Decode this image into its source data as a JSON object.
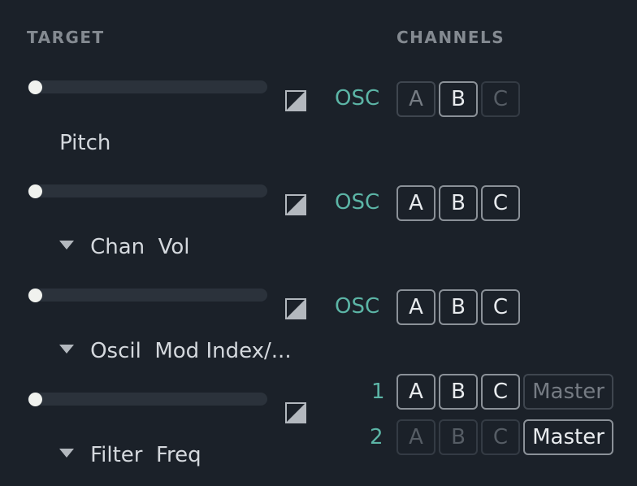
{
  "headers": {
    "target": "TARGET",
    "channels": "CHANNELS"
  },
  "rows": [
    {
      "label": "Pitch",
      "has_dropdown": false,
      "slider_value": 0,
      "prefix": "OSC",
      "buttons": [
        {
          "label": "A",
          "state": "dim"
        },
        {
          "label": "B",
          "state": "on"
        },
        {
          "label": "C",
          "state": "off"
        }
      ]
    },
    {
      "label": "Chan  Vol",
      "has_dropdown": true,
      "slider_value": 0,
      "prefix": "OSC",
      "buttons": [
        {
          "label": "A",
          "state": "on"
        },
        {
          "label": "B",
          "state": "on"
        },
        {
          "label": "C",
          "state": "on"
        }
      ]
    },
    {
      "label": "Oscil  Mod Index/...",
      "has_dropdown": true,
      "slider_value": 0,
      "prefix": "OSC",
      "buttons": [
        {
          "label": "A",
          "state": "on"
        },
        {
          "label": "B",
          "state": "on"
        },
        {
          "label": "C",
          "state": "on"
        }
      ]
    },
    {
      "label": "Filter  Freq",
      "has_dropdown": true,
      "slider_value": 0,
      "filter_rows": [
        {
          "prefix": "1",
          "buttons": [
            {
              "label": "A",
              "state": "on"
            },
            {
              "label": "B",
              "state": "on"
            },
            {
              "label": "C",
              "state": "on"
            },
            {
              "label": "Master",
              "state": "dim"
            }
          ]
        },
        {
          "prefix": "2",
          "buttons": [
            {
              "label": "A",
              "state": "off"
            },
            {
              "label": "B",
              "state": "off"
            },
            {
              "label": "C",
              "state": "off"
            },
            {
              "label": "Master",
              "state": "on"
            }
          ]
        }
      ]
    }
  ],
  "icons": {
    "curve": "curve-shape-icon",
    "dropdown": "dropdown-triangle-icon"
  },
  "colors": {
    "background": "#1b2129",
    "accent": "#5cb5a6",
    "track": "#2b323b",
    "thumb": "#f0f2ee"
  }
}
